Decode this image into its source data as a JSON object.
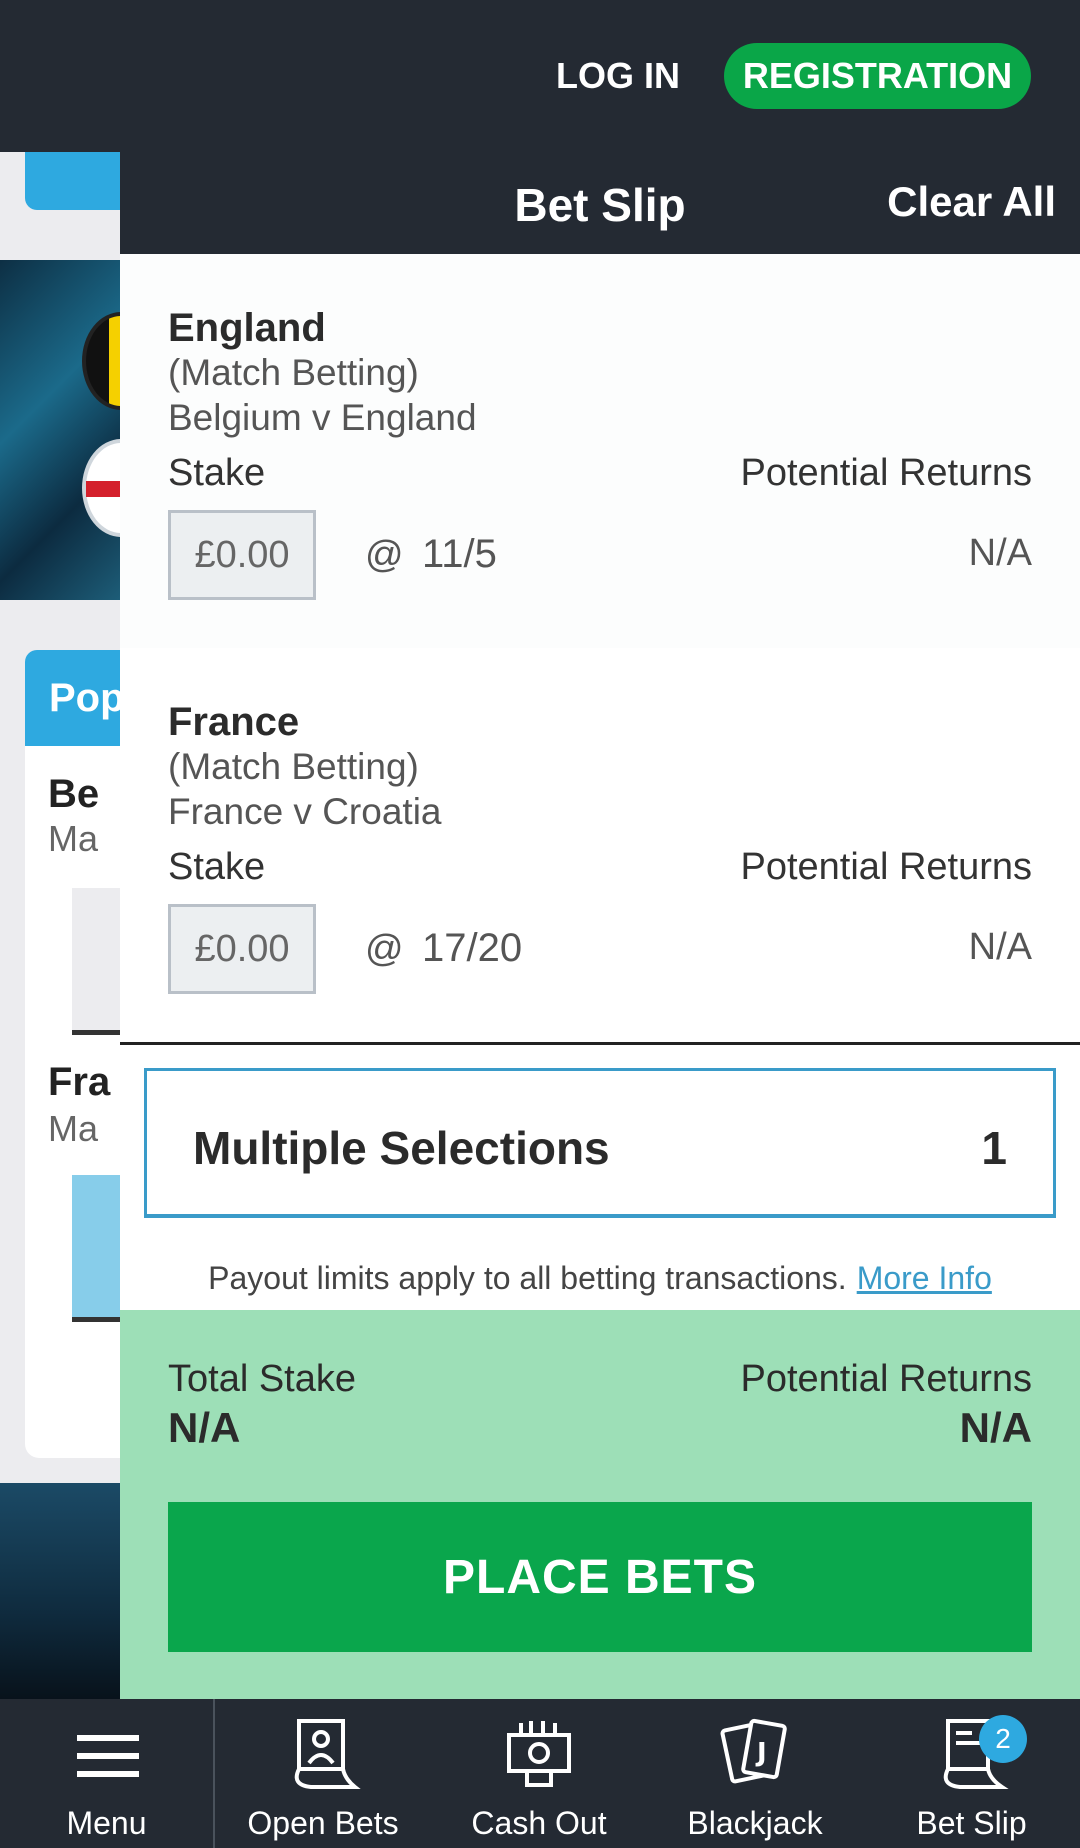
{
  "header": {
    "login_label": "LOG IN",
    "register_label": "REGISTRATION"
  },
  "background": {
    "popular_tab": "Pop",
    "item1_title": "Be",
    "item1_sub": "Ma",
    "item2_title": "Fra",
    "item2_sub": "Ma"
  },
  "betslip": {
    "title": "Bet Slip",
    "clear_all": "Clear All",
    "selections": [
      {
        "team": "England",
        "market": "(Match Betting)",
        "event": "Belgium v England",
        "stake_label": "Stake",
        "returns_label": "Potential Returns",
        "stake_value": "£0.00",
        "at": "@",
        "odds": "11/5",
        "returns": "N/A"
      },
      {
        "team": "France",
        "market": "(Match Betting)",
        "event": "France v Croatia",
        "stake_label": "Stake",
        "returns_label": "Potential Returns",
        "stake_value": "£0.00",
        "at": "@",
        "odds": "17/20",
        "returns": "N/A"
      }
    ],
    "multiple": {
      "label": "Multiple Selections",
      "count": "1"
    },
    "payout_text": "Payout limits apply to all betting transactions.",
    "more_info": "More Info",
    "summary": {
      "total_stake_label": "Total Stake",
      "total_stake_value": "N/A",
      "returns_label": "Potential Returns",
      "returns_value": "N/A"
    },
    "place_bets": "PLACE BETS"
  },
  "bottom_nav": {
    "items": [
      {
        "label": "Menu",
        "icon": "menu-icon"
      },
      {
        "label": "Open Bets",
        "icon": "open-bets-icon"
      },
      {
        "label": "Cash Out",
        "icon": "cash-out-icon"
      },
      {
        "label": "Blackjack",
        "icon": "blackjack-icon"
      },
      {
        "label": "Bet Slip",
        "icon": "bet-slip-icon",
        "badge": "2"
      }
    ]
  },
  "colors": {
    "dark": "#242a33",
    "green": "#0aa64c",
    "light_green": "#9ddfb7",
    "blue": "#2ea9e0"
  }
}
